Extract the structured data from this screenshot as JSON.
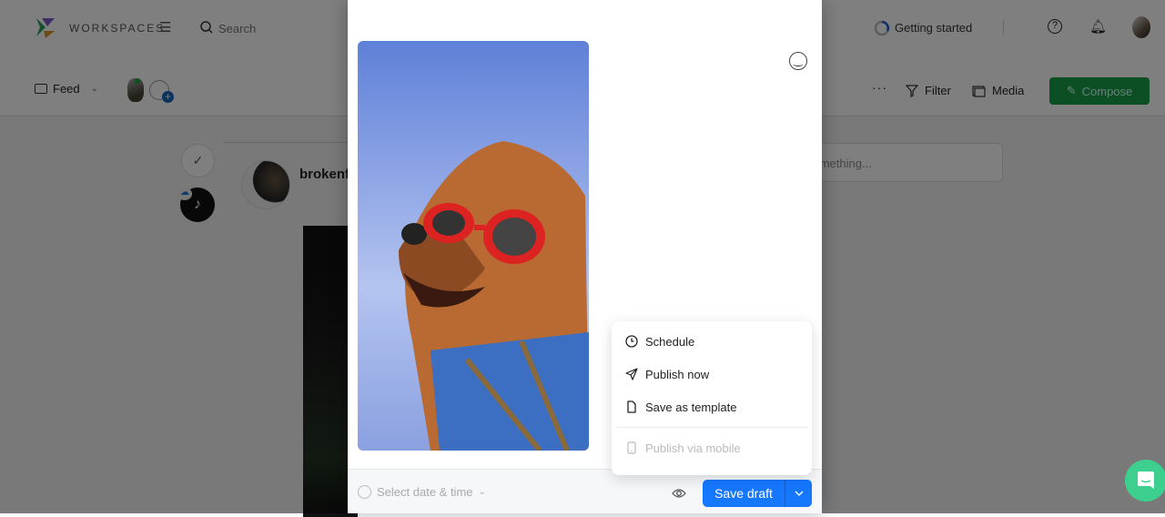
{
  "header": {
    "brand": "WORKSPACES",
    "search_placeholder": "Search",
    "getting_started": "Getting started"
  },
  "toolbar": {
    "feed_label": "Feed",
    "filter_label": "Filter",
    "media_label": "Media",
    "compose_label": "Compose",
    "compose_color": "#16a34a"
  },
  "feed": {
    "username": "brokenf",
    "comment_placeholder": "something..."
  },
  "composer": {
    "date_placeholder": "Select date & time",
    "save_draft_label": "Save draft",
    "accent": "#1677ff"
  },
  "menu": {
    "items": [
      {
        "label": "Schedule",
        "icon": "clock-icon",
        "disabled": false
      },
      {
        "label": "Publish now",
        "icon": "send-icon",
        "disabled": false
      },
      {
        "label": "Save as template",
        "icon": "file-icon",
        "disabled": false
      },
      {
        "label": "Publish via mobile",
        "icon": "mobile-icon",
        "disabled": true
      }
    ]
  }
}
